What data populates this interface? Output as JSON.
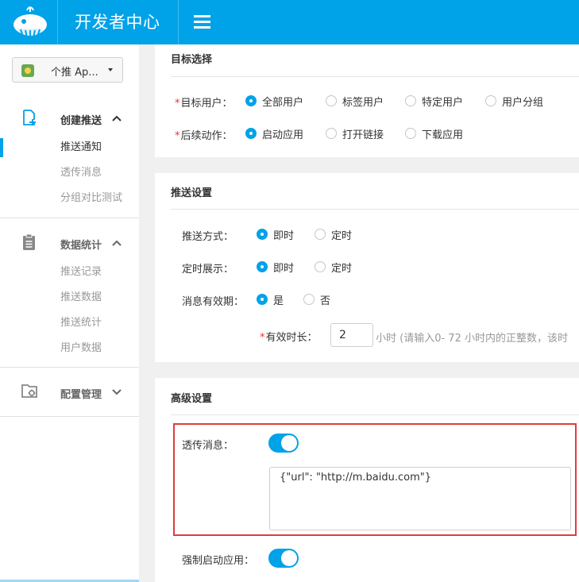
{
  "header": {
    "brand": "开发者中心"
  },
  "sidebar": {
    "app_selector": "个推 Ap...",
    "groups": [
      {
        "title": "创建推送",
        "items": [
          "推送通知",
          "透传消息",
          "分组对比测试"
        ]
      },
      {
        "title": "数据统计",
        "items": [
          "推送记录",
          "推送数据",
          "推送统计",
          "用户数据"
        ]
      },
      {
        "title": "配置管理",
        "items": []
      }
    ]
  },
  "target": {
    "title": "目标选择",
    "users_label": "目标用户：",
    "users_options": [
      "全部用户",
      "标签用户",
      "特定用户",
      "用户分组"
    ],
    "users_selected": "全部用户",
    "action_label": "后续动作：",
    "action_options": [
      "启动应用",
      "打开链接",
      "下载应用"
    ],
    "action_selected": "启动应用"
  },
  "push_settings": {
    "title": "推送设置",
    "method_label": "推送方式：",
    "method_options": [
      "即时",
      "定时"
    ],
    "display_label": "定时展示：",
    "display_options": [
      "即时",
      "定时"
    ],
    "validity_label": "消息有效期：",
    "validity_options": [
      "是",
      "否"
    ],
    "duration_label": "有效时长：",
    "duration_value": "2",
    "duration_hint": "小时 (请输入0- 72 小时内的正整数，该时"
  },
  "advanced": {
    "title": "高级设置",
    "passthrough_label": "透传消息：",
    "passthrough_content": "{\"url\": \"http://m.baidu.com\"}",
    "force_launch_label": "强制启动应用："
  },
  "colors": {
    "accent": "#00a2e8",
    "highlight": "#e03c3c"
  }
}
